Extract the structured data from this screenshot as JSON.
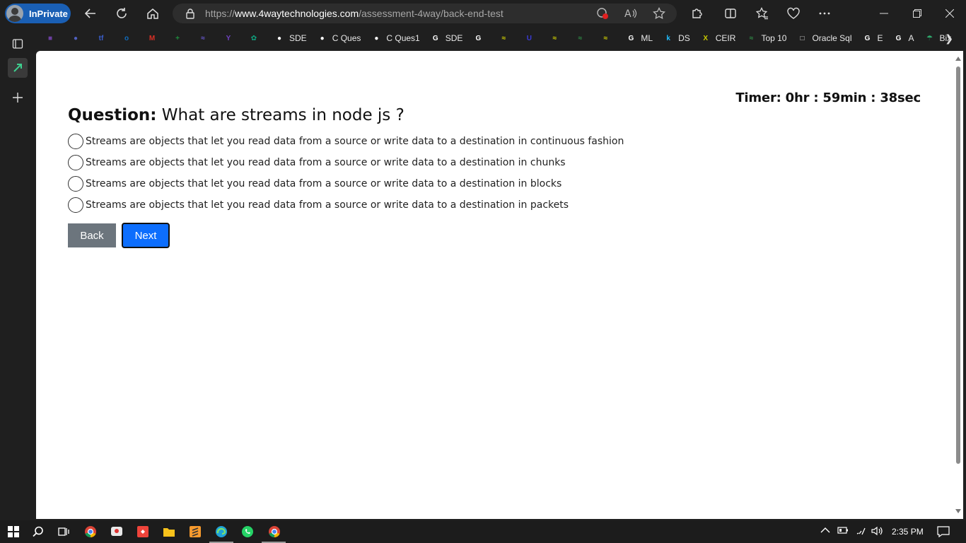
{
  "browser": {
    "inprivate_label": "InPrivate",
    "url_prefix": "https://",
    "url_host": "www.4waytechnologies.com",
    "url_path": "/assessment-4way/back-end-test"
  },
  "favorites": [
    {
      "label": "",
      "icon": "purple-app-icon",
      "color": "#6b3fa0"
    },
    {
      "label": "",
      "icon": "circle-logo-icon",
      "color": "#5060c0"
    },
    {
      "label": "",
      "icon": "tf-icon",
      "color": "#3a5fcd"
    },
    {
      "label": "",
      "icon": "outlook-icon",
      "color": "#0f6cbd"
    },
    {
      "label": "",
      "icon": "gmail-icon",
      "color": "#d93025"
    },
    {
      "label": "",
      "icon": "sheets-icon",
      "color": "#1e8e3e"
    },
    {
      "label": "",
      "icon": "swirl-icon",
      "color": "#6b5bd6"
    },
    {
      "label": "",
      "icon": "branch-icon",
      "color": "#6f42c1"
    },
    {
      "label": "",
      "icon": "openai-icon",
      "color": "#10a37f"
    },
    {
      "label": "SDE",
      "icon": "github-icon",
      "color": "#ffffff"
    },
    {
      "label": "C Ques",
      "icon": "github-icon",
      "color": "#ffffff"
    },
    {
      "label": "C Ques1",
      "icon": "github-icon",
      "color": "#ffffff"
    },
    {
      "label": "SDE",
      "icon": "google-icon",
      "color": "#ffffff"
    },
    {
      "label": "",
      "icon": "google-icon",
      "color": "#ffffff"
    },
    {
      "label": "",
      "icon": "leaf-icon",
      "color": "#d4d400"
    },
    {
      "label": "",
      "icon": "u-icon",
      "color": "#3a3ad6"
    },
    {
      "label": "",
      "icon": "leaf-icon",
      "color": "#d4d400"
    },
    {
      "label": "",
      "icon": "gfg-icon",
      "color": "#2f8d46"
    },
    {
      "label": "",
      "icon": "leaf-icon",
      "color": "#d4d400"
    },
    {
      "label": "ML",
      "icon": "google-icon",
      "color": "#ffffff"
    },
    {
      "label": "DS",
      "icon": "k-icon",
      "color": "#20beff"
    },
    {
      "label": "CEIR",
      "icon": "ceir-icon",
      "color": "#c8c800"
    },
    {
      "label": "Top 10",
      "icon": "gfg-icon",
      "color": "#2f8d46"
    },
    {
      "label": "Oracle Sql",
      "icon": "page-icon",
      "color": "#dddddd"
    },
    {
      "label": "E",
      "icon": "g-icon",
      "color": "#ffffff"
    },
    {
      "label": "A",
      "icon": "google-icon",
      "color": "#ffffff"
    },
    {
      "label": "Bix",
      "icon": "umbrella-icon",
      "color": "#2fa86c"
    }
  ],
  "assessment": {
    "timer": "Timer: 0hr : 59min : 38sec",
    "question_label": "Question:",
    "question_text": "What are streams in node js ?",
    "options": [
      "Streams are objects that let you read data from a source or write data to a destination in continuous fashion",
      "Streams are objects that let you read data from a source or write data to a destination in chunks",
      "Streams are objects that let you read data from a source or write data to a destination in blocks",
      "Streams are objects that let you read data from a source or write data to a destination in packets"
    ],
    "back_label": "Back",
    "next_label": "Next"
  },
  "taskbar": {
    "time": "2:35 PM"
  },
  "colors": {
    "next_button": "#0d6efd",
    "back_button": "#6c757d",
    "inprivate_badge": "#1a5fb4"
  }
}
